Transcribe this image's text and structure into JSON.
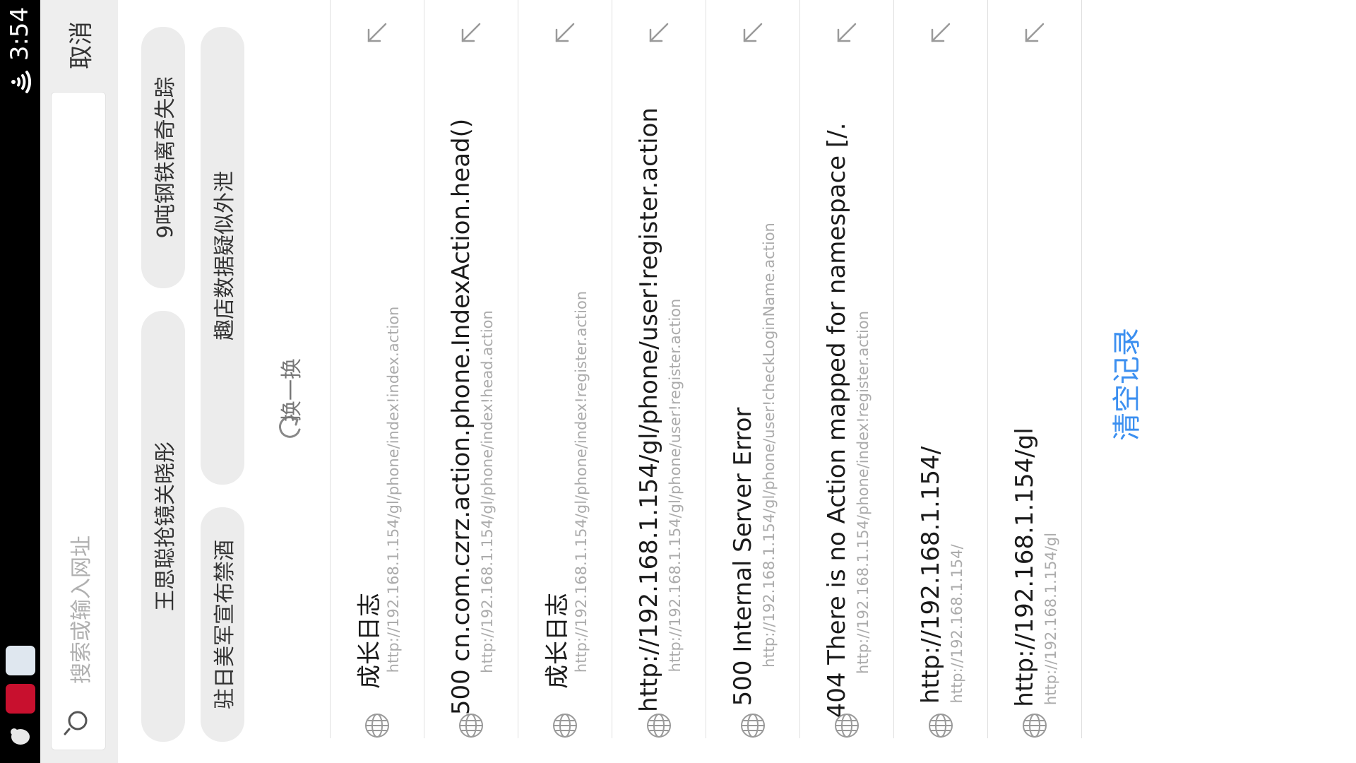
{
  "status_bar": {
    "time": "3:54",
    "icons": [
      "wifi-icon",
      "notification-app-icon",
      "notification-badge-icon",
      "notification-qq-icon"
    ]
  },
  "search": {
    "placeholder": "搜索或输入网址",
    "cancel_label": "取消"
  },
  "hot_searches": {
    "chips": [
      "王思聪抢镜关晓彤",
      "9吨钢铁离奇失踪",
      "驻日美军宣布禁酒",
      "趣店数据疑似外泄"
    ],
    "refresh_label": "换一换"
  },
  "history": {
    "items": [
      {
        "title": "成长日志",
        "url": "http://192.168.1.154/gl/phone/index!index.action"
      },
      {
        "title": "500 cn.com.czrz.action.phone.IndexAction.head()",
        "url": "http://192.168.1.154/gl/phone/index!head.action"
      },
      {
        "title": "成长日志",
        "url": "http://192.168.1.154/gl/phone/index!register.action"
      },
      {
        "title": "http://192.168.1.154/gl/phone/user!register.action",
        "url": "http://192.168.1.154/gl/phone/user!register.action"
      },
      {
        "title": "500 Internal Server Error",
        "url": "http://192.168.1.154/gl/phone/user!checkLoginName.action"
      },
      {
        "title": "404 There is no Action mapped for namespace [/.",
        "url": "http://192.168.1.154/phone/index!register.action"
      },
      {
        "title": "http://192.168.1.154/",
        "url": "http://192.168.1.154/"
      },
      {
        "title": "http://192.168.1.154/gl",
        "url": "http://192.168.1.154/gl"
      }
    ],
    "clear_label": "清空记录"
  },
  "colors": {
    "accent": "#3b8ff0",
    "status_bar_bg": "#000000",
    "search_panel_bg": "#eeeeee",
    "chip_bg": "#ececec"
  }
}
